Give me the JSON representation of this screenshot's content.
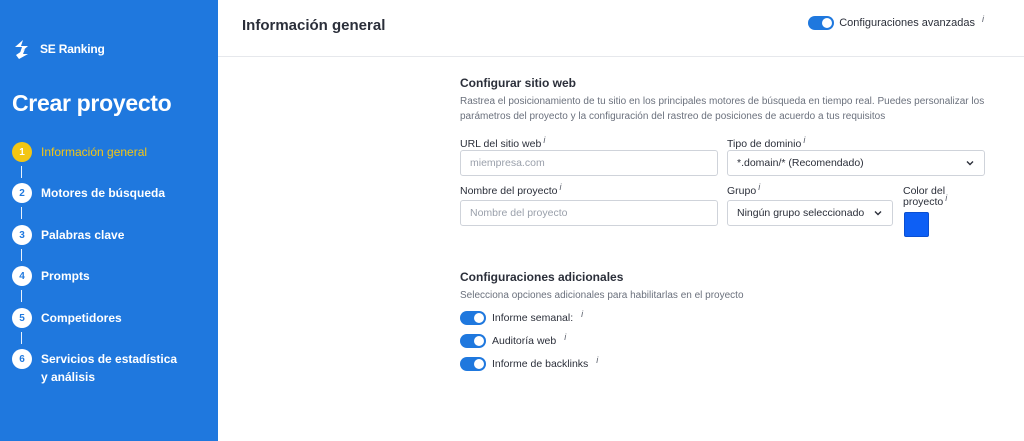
{
  "sidebar": {
    "logo_text": "SE Ranking",
    "title": "Crear proyecto",
    "steps": [
      {
        "num": "1",
        "label": "Información general"
      },
      {
        "num": "2",
        "label": "Motores de búsqueda"
      },
      {
        "num": "3",
        "label": "Palabras clave"
      },
      {
        "num": "4",
        "label": "Prompts"
      },
      {
        "num": "5",
        "label": "Competidores"
      },
      {
        "num": "6",
        "label": "Servicios de estadística y análisis"
      }
    ]
  },
  "header": {
    "title": "Información general",
    "advanced_label": "Configuraciones avanzadas",
    "info": "i"
  },
  "site": {
    "title": "Configurar sitio web",
    "description": "Rastrea el posicionamiento de tu sitio en los principales motores de búsqueda en tiempo real. Puedes personalizar los parámetros del proyecto y la configuración del rastreo de posiciones de acuerdo a tus requisitos",
    "url_label": "URL del sitio web",
    "url_value": "",
    "url_placeholder": "miempresa.com",
    "domain_label": "Tipo de dominio",
    "domain_value": "*.domain/* (Recomendado)",
    "name_label": "Nombre del proyecto",
    "name_value": "",
    "name_placeholder": "Nombre del proyecto",
    "group_label": "Grupo",
    "group_value": "Ningún grupo seleccionado",
    "color_label": "Color del proyecto",
    "color_value": "#0d5ff5"
  },
  "additional": {
    "title": "Configuraciones adicionales",
    "description": "Selecciona opciones adicionales para habilitarlas en el proyecto",
    "options": [
      {
        "label": "Informe semanal:",
        "on": true
      },
      {
        "label": "Auditoría web",
        "on": true
      },
      {
        "label": "Informe de backlinks",
        "on": true
      }
    ]
  },
  "colors": {
    "sidebar": "#1f78de",
    "active_step": "#f3c614",
    "toggle_on": "#1f78de"
  }
}
